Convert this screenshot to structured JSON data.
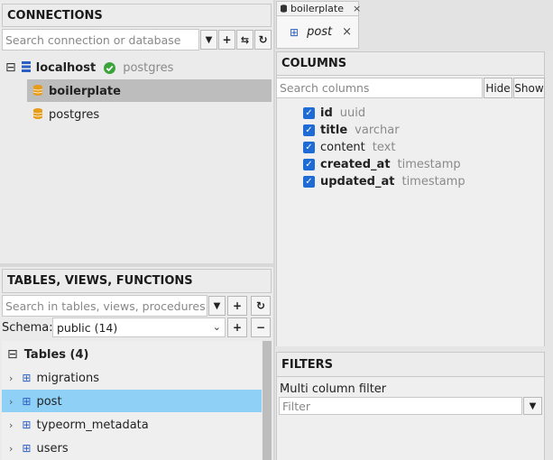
{
  "connections": {
    "title": "CONNECTIONS",
    "search_placeholder": "Search connection or database",
    "toolbar": {
      "filter": "▼",
      "add": "+",
      "connect": "⇆",
      "refresh": "↻"
    },
    "tree": {
      "expand_icon": "⊟",
      "host": "localhost",
      "host_driver": "postgres",
      "databases": [
        "boilerplate",
        "postgres"
      ]
    }
  },
  "tables": {
    "title": "TABLES, VIEWS, FUNCTIONS",
    "search_placeholder": "Search in tables, views, procedures",
    "schema_label": "Schema:",
    "schema_value": "public (14)",
    "group_label": "Tables (4)",
    "items": [
      "migrations",
      "post",
      "typeorm_metadata",
      "users"
    ]
  },
  "tabs": {
    "connection_tab": "boilerplate",
    "table_tab": "post"
  },
  "columns": {
    "title": "COLUMNS",
    "search_placeholder": "Search columns",
    "hide_label": "Hide",
    "show_label": "Show",
    "items": [
      {
        "name": "id",
        "type": "uuid"
      },
      {
        "name": "title",
        "type": "varchar"
      },
      {
        "name": "content",
        "type": "text"
      },
      {
        "name": "created_at",
        "type": "timestamp"
      },
      {
        "name": "updated_at",
        "type": "timestamp"
      }
    ]
  },
  "filters": {
    "title": "FILTERS",
    "multi_label": "Multi column filter",
    "filter_placeholder": "Filter"
  },
  "colors": {
    "selected_db": "#bdbdbd",
    "selected_table": "#8fd0f7",
    "accent": "#1e6bd6"
  }
}
